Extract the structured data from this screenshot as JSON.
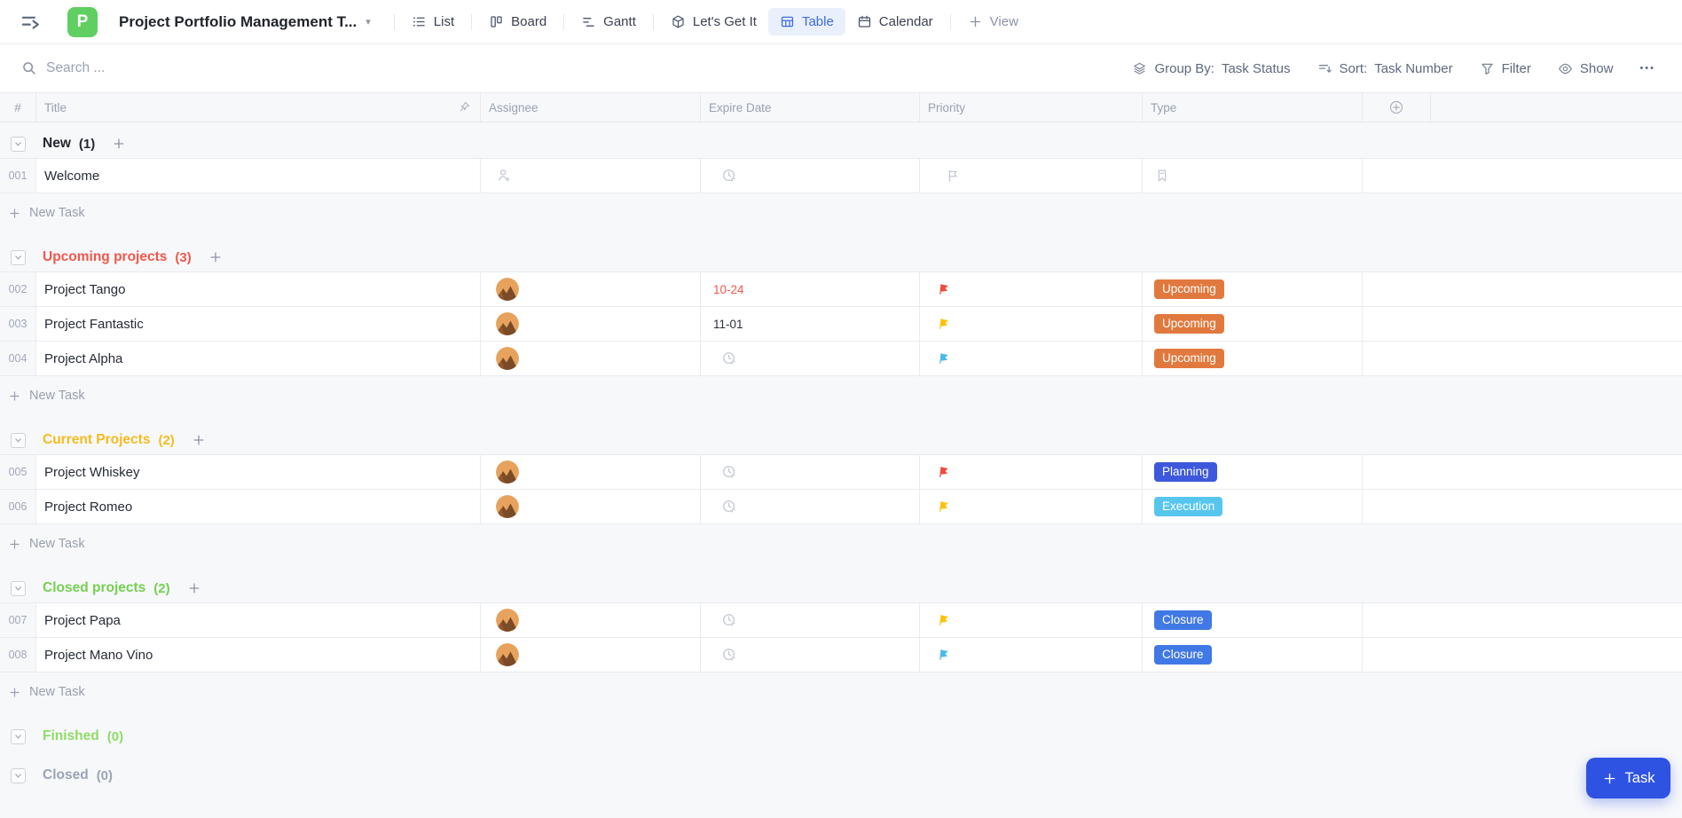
{
  "header": {
    "logo": {
      "letter": "P",
      "color": "#60cf61"
    },
    "title": "Project Portfolio Management T...",
    "tabs": [
      {
        "label": "List",
        "icon": "list-icon",
        "active": false
      },
      {
        "label": "Board",
        "icon": "board-icon",
        "active": false
      },
      {
        "label": "Gantt",
        "icon": "gantt-icon",
        "active": false
      },
      {
        "label": "Let's Get It",
        "icon": "cube-icon",
        "active": false
      },
      {
        "label": "Table",
        "icon": "table-icon",
        "active": true
      },
      {
        "label": "Calendar",
        "icon": "calendar-icon",
        "active": false
      }
    ],
    "add_view": {
      "label": "View",
      "icon": "plus-icon"
    },
    "active_tab_color": "#3b6ce0"
  },
  "toolbar": {
    "search": {
      "placeholder": "Search ...",
      "icon": "search-icon"
    },
    "group_by": {
      "label": "Group By:",
      "value": "Task Status",
      "icon": "layers-icon"
    },
    "sort": {
      "label": "Sort:",
      "value": "Task Number",
      "icon": "sort-icon"
    },
    "filter": {
      "label": "Filter",
      "icon": "filter-icon"
    },
    "show": {
      "label": "Show",
      "icon": "eye-icon"
    },
    "more": {
      "label": "•••",
      "icon": "ellipsis-icon"
    }
  },
  "table": {
    "columns": [
      {
        "key": "num",
        "label": "#"
      },
      {
        "key": "title",
        "label": "Title",
        "icon": "pin-icon"
      },
      {
        "key": "assignee",
        "label": "Assignee"
      },
      {
        "key": "expire",
        "label": "Expire Date"
      },
      {
        "key": "priority",
        "label": "Priority"
      },
      {
        "key": "type",
        "label": "Type"
      }
    ],
    "add_column_icon": "plus-circle-icon",
    "new_task_label": "New Task",
    "flag_colors": {
      "red": "#f04a3e",
      "yellow": "#fdc108",
      "blue": "#4ab9ec"
    },
    "groups": [
      {
        "name": "New",
        "count_display": "(1)",
        "color": "#23272f",
        "has_add_button": true,
        "show_new_task": true,
        "rows": [
          {
            "num": "001",
            "title": "Welcome",
            "assignee": null,
            "expire": null,
            "overdue": false,
            "priority": null,
            "type": null
          }
        ]
      },
      {
        "name": "Upcoming projects",
        "count_display": "(3)",
        "color": "#f2574b",
        "has_add_button": true,
        "show_new_task": true,
        "rows": [
          {
            "num": "002",
            "title": "Project Tango",
            "assignee": "avatar",
            "expire": "10-24",
            "overdue": true,
            "priority": "red",
            "type": {
              "label": "Upcoming",
              "color": "#e1793e"
            }
          },
          {
            "num": "003",
            "title": "Project Fantastic",
            "assignee": "avatar",
            "expire": "11-01",
            "overdue": false,
            "priority": "yellow",
            "type": {
              "label": "Upcoming",
              "color": "#e1793e"
            }
          },
          {
            "num": "004",
            "title": "Project Alpha",
            "assignee": "avatar",
            "expire": null,
            "overdue": false,
            "priority": "blue",
            "type": {
              "label": "Upcoming",
              "color": "#e1793e"
            }
          }
        ]
      },
      {
        "name": "Current Projects",
        "count_display": "(2)",
        "color": "#f6bb1e",
        "has_add_button": true,
        "show_new_task": true,
        "rows": [
          {
            "num": "005",
            "title": "Project Whiskey",
            "assignee": "avatar",
            "expire": null,
            "overdue": false,
            "priority": "red",
            "type": {
              "label": "Planning",
              "color": "#3d58dc"
            }
          },
          {
            "num": "006",
            "title": "Project Romeo",
            "assignee": "avatar",
            "expire": null,
            "overdue": false,
            "priority": "yellow",
            "type": {
              "label": "Execution",
              "color": "#57c6ee"
            }
          }
        ]
      },
      {
        "name": "Closed projects",
        "count_display": "(2)",
        "color": "#74d052",
        "has_add_button": true,
        "show_new_task": true,
        "rows": [
          {
            "num": "007",
            "title": "Project Papa",
            "assignee": "avatar",
            "expire": null,
            "overdue": false,
            "priority": "yellow",
            "type": {
              "label": "Closure",
              "color": "#4079e6"
            }
          },
          {
            "num": "008",
            "title": "Project Mano Vino",
            "assignee": "avatar",
            "expire": null,
            "overdue": false,
            "priority": "blue",
            "type": {
              "label": "Closure",
              "color": "#4079e6"
            }
          }
        ]
      },
      {
        "name": "Finished",
        "count_display": "(0)",
        "color": "#8edd66",
        "has_add_button": false,
        "show_new_task": false,
        "rows": []
      },
      {
        "name": "Closed",
        "count_display": "(0)",
        "color": "#9aa4b5",
        "has_add_button": false,
        "show_new_task": false,
        "rows": []
      }
    ]
  },
  "task_button": {
    "label": "Task",
    "color": "#2e53e3"
  }
}
